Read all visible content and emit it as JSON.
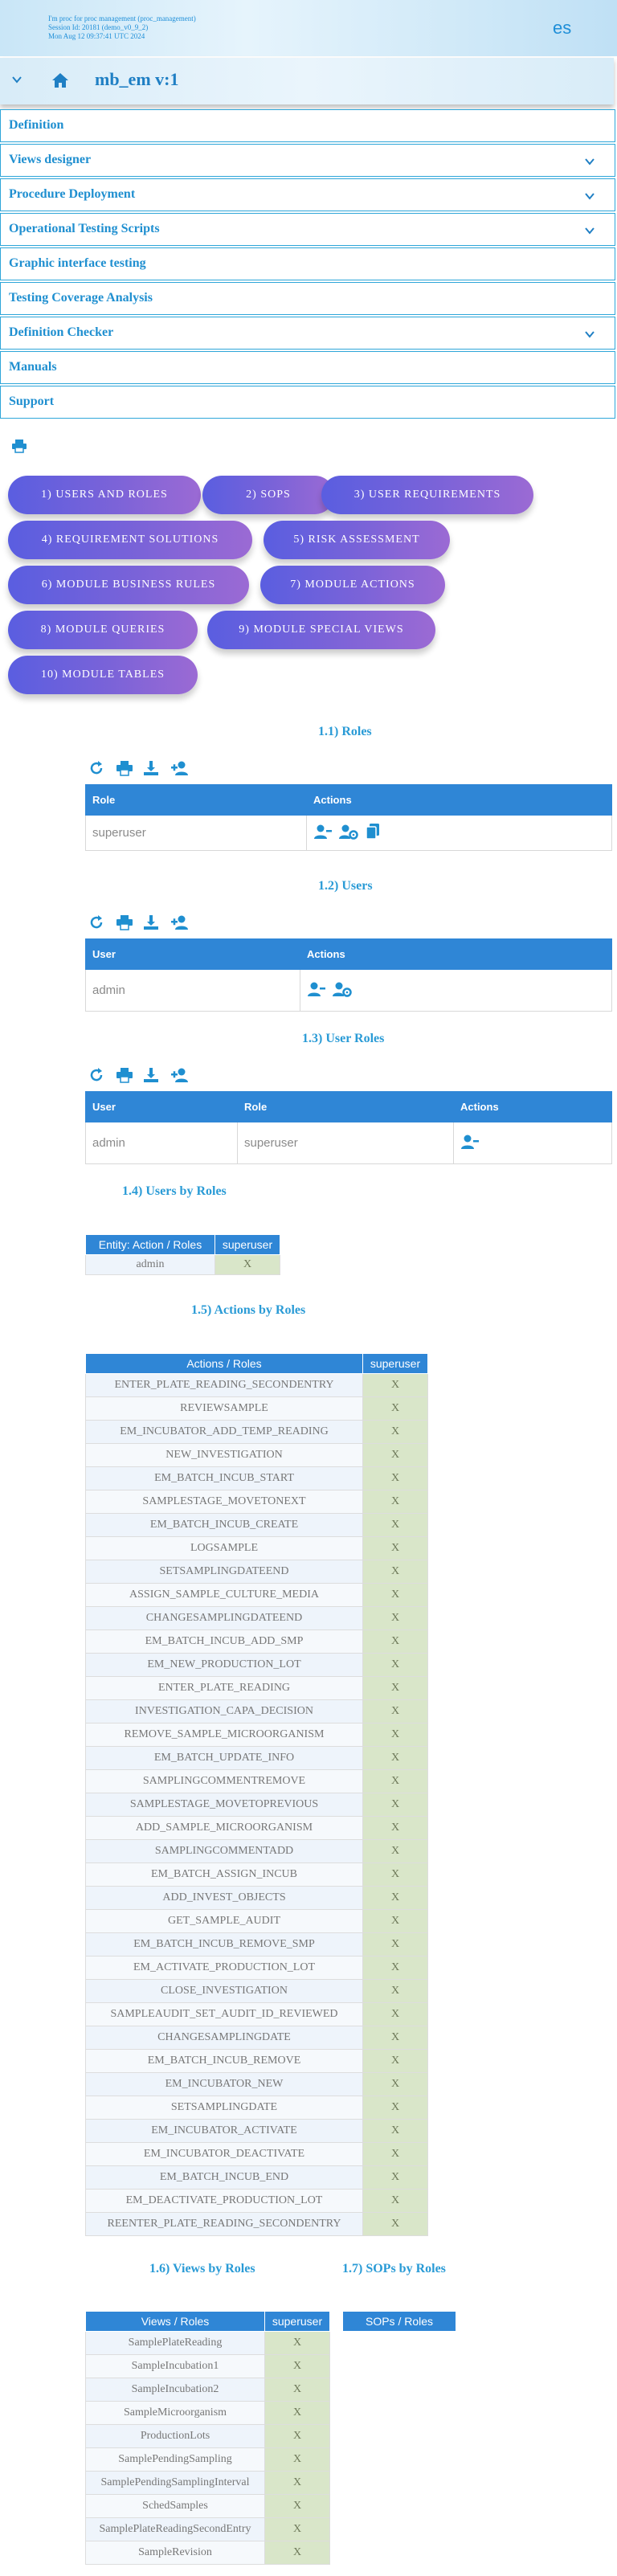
{
  "header": {
    "info_line1": "I'm proc for proc management (proc_management)",
    "info_line2": "Session Id: 20181 (demo_v0_9_2)",
    "info_line3": "Mon Aug 12 09:37:41 UTC 2024",
    "language": "es"
  },
  "navbar": {
    "title": "mb_em v:1"
  },
  "menu": [
    {
      "label": "Definition",
      "dropdown": false
    },
    {
      "label": "Views designer",
      "dropdown": true
    },
    {
      "label": "Procedure Deployment",
      "dropdown": true
    },
    {
      "label": "Operational Testing Scripts",
      "dropdown": true
    },
    {
      "label": "Graphic interface testing",
      "dropdown": false
    },
    {
      "label": "Testing Coverage Analysis",
      "dropdown": false
    },
    {
      "label": "Definition Checker",
      "dropdown": true
    },
    {
      "label": "Manuals",
      "dropdown": false
    },
    {
      "label": "Support",
      "dropdown": false
    }
  ],
  "tabs": [
    "1) USERS AND ROLES",
    "2) SOPS",
    "3) USER REQUIREMENTS",
    "4) REQUIREMENT SOLUTIONS",
    "5) RISK ASSESSMENT",
    "6) MODULE BUSINESS RULES",
    "7) MODULE ACTIONS",
    "8) MODULE QUERIES",
    "9) MODULE SPECIAL VIEWS",
    "10) MODULE TABLES"
  ],
  "sections": {
    "roles": {
      "title": "1.1) Roles",
      "col_role": "Role",
      "col_actions": "Actions",
      "row": "superuser"
    },
    "users": {
      "title": "1.2) Users",
      "col_user": "User",
      "col_actions": "Actions",
      "row": "admin"
    },
    "user_roles": {
      "title": "1.3) User Roles",
      "col_user": "User",
      "col_role": "Role",
      "col_actions": "Actions",
      "row_user": "admin",
      "row_role": "superuser"
    },
    "users_by_roles": {
      "title": "1.4) Users by Roles",
      "col_header": "Entity: Action / Roles",
      "col_role": "superuser",
      "row": "admin",
      "mark": "X"
    },
    "actions_by_roles": {
      "title": "1.5) Actions by Roles",
      "col_header": "Actions / Roles",
      "col_role": "superuser",
      "mark": "X",
      "rows": [
        "ENTER_PLATE_READING_SECONDENTRY",
        "REVIEWSAMPLE",
        "EM_INCUBATOR_ADD_TEMP_READING",
        "NEW_INVESTIGATION",
        "EM_BATCH_INCUB_START",
        "SAMPLESTAGE_MOVETONEXT",
        "EM_BATCH_INCUB_CREATE",
        "LOGSAMPLE",
        "SETSAMPLINGDATEEND",
        "ASSIGN_SAMPLE_CULTURE_MEDIA",
        "CHANGESAMPLINGDATEEND",
        "EM_BATCH_INCUB_ADD_SMP",
        "EM_NEW_PRODUCTION_LOT",
        "ENTER_PLATE_READING",
        "INVESTIGATION_CAPA_DECISION",
        "REMOVE_SAMPLE_MICROORGANISM",
        "EM_BATCH_UPDATE_INFO",
        "SAMPLINGCOMMENTREMOVE",
        "SAMPLESTAGE_MOVETOPREVIOUS",
        "ADD_SAMPLE_MICROORGANISM",
        "SAMPLINGCOMMENTADD",
        "EM_BATCH_ASSIGN_INCUB",
        "ADD_INVEST_OBJECTS",
        "GET_SAMPLE_AUDIT",
        "EM_BATCH_INCUB_REMOVE_SMP",
        "EM_ACTIVATE_PRODUCTION_LOT",
        "CLOSE_INVESTIGATION",
        "SAMPLEAUDIT_SET_AUDIT_ID_REVIEWED",
        "CHANGESAMPLINGDATE",
        "EM_BATCH_INCUB_REMOVE",
        "EM_INCUBATOR_NEW",
        "SETSAMPLINGDATE",
        "EM_INCUBATOR_ACTIVATE",
        "EM_INCUBATOR_DEACTIVATE",
        "EM_BATCH_INCUB_END",
        "EM_DEACTIVATE_PRODUCTION_LOT",
        "REENTER_PLATE_READING_SECONDENTRY"
      ]
    },
    "views_by_roles": {
      "title": "1.6) Views by Roles",
      "col_header": "Views / Roles",
      "col_role": "superuser",
      "mark": "X",
      "rows": [
        "SamplePlateReading",
        "SampleIncubation1",
        "SampleIncubation2",
        "SampleMicroorganism",
        "ProductionLots",
        "SamplePendingSampling",
        "SamplePendingSamplingInterval",
        "SchedSamples",
        "SamplePlateReadingSecondEntry",
        "SampleRevision"
      ]
    },
    "sops_by_roles": {
      "title": "1.7) SOPs by Roles",
      "col_header": "SOPs / Roles"
    }
  },
  "colors": {
    "accent": "#2f86d6",
    "pill_start": "#5a5ee0",
    "pill_end": "#9b6ad4",
    "mark_bg": "#d9e6c9"
  }
}
